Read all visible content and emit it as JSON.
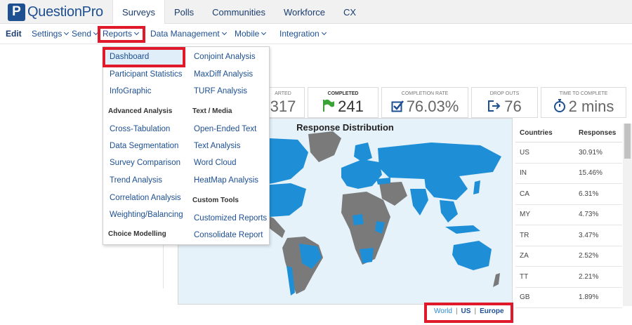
{
  "brand": {
    "logo_letter": "P",
    "name": "QuestionPro",
    "color": "#1d4f91"
  },
  "top_tabs": [
    {
      "label": "Surveys",
      "active": true
    },
    {
      "label": "Polls"
    },
    {
      "label": "Communities"
    },
    {
      "label": "Workforce"
    },
    {
      "label": "CX"
    }
  ],
  "sub_nav": {
    "edit": "Edit",
    "settings": "Settings",
    "send": "Send",
    "reports": "Reports",
    "data_management": "Data Management",
    "mobile": "Mobile",
    "integration": "Integration"
  },
  "reports_menu": {
    "col1": {
      "items": [
        "Dashboard",
        "Participant Statistics",
        "InfoGraphic"
      ],
      "heading_advanced": "Advanced Analysis",
      "advanced": [
        "Cross-Tabulation",
        "Data Segmentation",
        "Survey Comparison",
        "Trend Analysis",
        "Correlation Analysis",
        "Weighting/Balancing"
      ],
      "heading_choice": "Choice Modelling"
    },
    "col2": {
      "items": [
        "Conjoint Analysis",
        "MaxDiff Analysis",
        "TURF Analysis"
      ],
      "heading_text": "Text / Media",
      "text_media": [
        "Open-Ended Text",
        "Text Analysis",
        "Word Cloud",
        "HeatMap Analysis"
      ],
      "heading_custom": "Custom Tools",
      "custom": [
        "Customized Reports",
        "Consolidate Report"
      ]
    }
  },
  "stats": {
    "started": {
      "label": "ARTED",
      "value": "317"
    },
    "completed": {
      "label": "COMPLETED",
      "value": "241"
    },
    "completion_rate": {
      "label": "COMPLETION RATE",
      "value": "76.03%"
    },
    "drop_outs": {
      "label": "DROP OUTS",
      "value": "76"
    },
    "time_to_complete": {
      "label": "TIME TO COMPLETE",
      "value": "2 mins"
    }
  },
  "map": {
    "title": "Response Distribution",
    "ocean_color": "#e6f2fa",
    "responded_color": "#1e8fd6",
    "no_response_color": "#7a7a7a"
  },
  "countries_table": {
    "headers": [
      "Countries",
      "Responses"
    ],
    "rows": [
      [
        "US",
        "30.91%"
      ],
      [
        "IN",
        "15.46%"
      ],
      [
        "CA",
        "6.31%"
      ],
      [
        "MY",
        "4.73%"
      ],
      [
        "TR",
        "3.47%"
      ],
      [
        "ZA",
        "2.52%"
      ],
      [
        "TT",
        "2.21%"
      ],
      [
        "GB",
        "1.89%"
      ]
    ]
  },
  "regions": {
    "world": "World",
    "us": "US",
    "europe": "Europe"
  },
  "colors": {
    "highlight_red": "#e0192b",
    "link_blue": "#1d4f91"
  }
}
